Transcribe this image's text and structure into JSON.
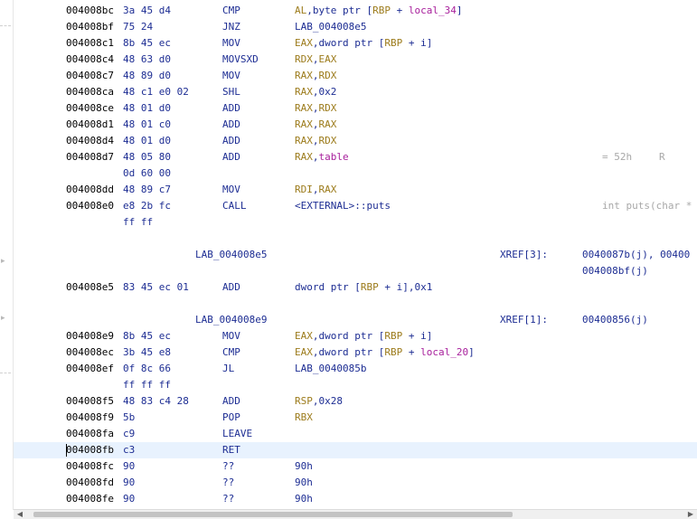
{
  "rows": [
    {
      "type": "ins",
      "addr": "004008bc",
      "bytes": "3a 45 d4",
      "mnem": "CMP",
      "ops": [
        {
          "t": "reg",
          "v": "AL"
        },
        {
          "t": "p",
          "v": ",byte ptr ["
        },
        {
          "t": "reg",
          "v": "RBP"
        },
        {
          "t": "p",
          "v": " + "
        },
        {
          "t": "var",
          "v": "local_34"
        },
        {
          "t": "p",
          "v": "]"
        }
      ]
    },
    {
      "type": "ins",
      "addr": "004008bf",
      "bytes": "75 24",
      "mnem": "JNZ",
      "ops": [
        {
          "t": "p",
          "v": "LAB_004008e5"
        }
      ]
    },
    {
      "type": "ins",
      "addr": "004008c1",
      "bytes": "8b 45 ec",
      "mnem": "MOV",
      "ops": [
        {
          "t": "reg",
          "v": "EAX"
        },
        {
          "t": "p",
          "v": ",dword ptr ["
        },
        {
          "t": "reg",
          "v": "RBP"
        },
        {
          "t": "p",
          "v": " + i]"
        }
      ]
    },
    {
      "type": "ins",
      "addr": "004008c4",
      "bytes": "48 63 d0",
      "mnem": "MOVSXD",
      "ops": [
        {
          "t": "reg",
          "v": "RDX"
        },
        {
          "t": "p",
          "v": ","
        },
        {
          "t": "reg",
          "v": "EAX"
        }
      ]
    },
    {
      "type": "ins",
      "addr": "004008c7",
      "bytes": "48 89 d0",
      "mnem": "MOV",
      "ops": [
        {
          "t": "reg",
          "v": "RAX"
        },
        {
          "t": "p",
          "v": ","
        },
        {
          "t": "reg",
          "v": "RDX"
        }
      ]
    },
    {
      "type": "ins",
      "addr": "004008ca",
      "bytes": "48 c1 e0 02",
      "mnem": "SHL",
      "ops": [
        {
          "t": "reg",
          "v": "RAX"
        },
        {
          "t": "p",
          "v": ",0x2"
        }
      ]
    },
    {
      "type": "ins",
      "addr": "004008ce",
      "bytes": "48 01 d0",
      "mnem": "ADD",
      "ops": [
        {
          "t": "reg",
          "v": "RAX"
        },
        {
          "t": "p",
          "v": ","
        },
        {
          "t": "reg",
          "v": "RDX"
        }
      ]
    },
    {
      "type": "ins",
      "addr": "004008d1",
      "bytes": "48 01 c0",
      "mnem": "ADD",
      "ops": [
        {
          "t": "reg",
          "v": "RAX"
        },
        {
          "t": "p",
          "v": ","
        },
        {
          "t": "reg",
          "v": "RAX"
        }
      ]
    },
    {
      "type": "ins",
      "addr": "004008d4",
      "bytes": "48 01 d0",
      "mnem": "ADD",
      "ops": [
        {
          "t": "reg",
          "v": "RAX"
        },
        {
          "t": "p",
          "v": ","
        },
        {
          "t": "reg",
          "v": "RDX"
        }
      ]
    },
    {
      "type": "ins",
      "addr": "004008d7",
      "bytes": "48 05 80",
      "mnem": "ADD",
      "ops": [
        {
          "t": "reg",
          "v": "RAX"
        },
        {
          "t": "p",
          "v": ","
        },
        {
          "t": "var",
          "v": "table"
        }
      ],
      "comment": "= 52h",
      "comment2": "R"
    },
    {
      "type": "cont",
      "bytes": "0d 60 00"
    },
    {
      "type": "ins",
      "addr": "004008dd",
      "bytes": "48 89 c7",
      "mnem": "MOV",
      "ops": [
        {
          "t": "reg",
          "v": "RDI"
        },
        {
          "t": "p",
          "v": ","
        },
        {
          "t": "reg",
          "v": "RAX"
        }
      ]
    },
    {
      "type": "ins",
      "addr": "004008e0",
      "bytes": "e8 2b fc",
      "mnem": "CALL",
      "ops": [
        {
          "t": "p",
          "v": "<EXTERNAL>::puts"
        }
      ],
      "comment": "int puts(char *"
    },
    {
      "type": "cont",
      "bytes": "ff ff"
    },
    {
      "type": "blank"
    },
    {
      "type": "label",
      "label": "LAB_004008e5",
      "xref": "XREF[3]:",
      "xrefv": "0040087b(j), 00400"
    },
    {
      "type": "xrefcont",
      "xrefv": "004008bf(j)"
    },
    {
      "type": "ins",
      "addr": "004008e5",
      "bytes": "83 45 ec 01",
      "mnem": "ADD",
      "ops": [
        {
          "t": "p",
          "v": "dword ptr ["
        },
        {
          "t": "reg",
          "v": "RBP"
        },
        {
          "t": "p",
          "v": " + i],0x1"
        }
      ]
    },
    {
      "type": "blank"
    },
    {
      "type": "label",
      "label": "LAB_004008e9",
      "xref": "XREF[1]:",
      "xrefv": "00400856(j)"
    },
    {
      "type": "ins",
      "addr": "004008e9",
      "bytes": "8b 45 ec",
      "mnem": "MOV",
      "ops": [
        {
          "t": "reg",
          "v": "EAX"
        },
        {
          "t": "p",
          "v": ",dword ptr ["
        },
        {
          "t": "reg",
          "v": "RBP"
        },
        {
          "t": "p",
          "v": " + i]"
        }
      ]
    },
    {
      "type": "ins",
      "addr": "004008ec",
      "bytes": "3b 45 e8",
      "mnem": "CMP",
      "ops": [
        {
          "t": "reg",
          "v": "EAX"
        },
        {
          "t": "p",
          "v": ",dword ptr ["
        },
        {
          "t": "reg",
          "v": "RBP"
        },
        {
          "t": "p",
          "v": " + "
        },
        {
          "t": "var",
          "v": "local_20"
        },
        {
          "t": "p",
          "v": "]"
        }
      ]
    },
    {
      "type": "ins",
      "addr": "004008ef",
      "bytes": "0f 8c 66",
      "mnem": "JL",
      "ops": [
        {
          "t": "p",
          "v": "LAB_0040085b"
        }
      ]
    },
    {
      "type": "cont",
      "bytes": "ff ff ff"
    },
    {
      "type": "ins",
      "addr": "004008f5",
      "bytes": "48 83 c4 28",
      "mnem": "ADD",
      "ops": [
        {
          "t": "reg",
          "v": "RSP"
        },
        {
          "t": "p",
          "v": ",0x28"
        }
      ]
    },
    {
      "type": "ins",
      "addr": "004008f9",
      "bytes": "5b",
      "mnem": "POP",
      "ops": [
        {
          "t": "reg",
          "v": "RBX"
        }
      ]
    },
    {
      "type": "ins",
      "addr": "004008fa",
      "bytes": "c9",
      "mnem": "LEAVE",
      "ops": []
    },
    {
      "type": "ins",
      "addr": "004008fb",
      "bytes": "c3",
      "mnem": "RET",
      "ops": [],
      "selected": true
    },
    {
      "type": "ins",
      "addr": "004008fc",
      "bytes": "90",
      "mnem": "??",
      "ops": [
        {
          "t": "p",
          "v": "90h"
        }
      ]
    },
    {
      "type": "ins",
      "addr": "004008fd",
      "bytes": "90",
      "mnem": "??",
      "ops": [
        {
          "t": "p",
          "v": "90h"
        }
      ]
    },
    {
      "type": "ins",
      "addr": "004008fe",
      "bytes": "90",
      "mnem": "??",
      "ops": [
        {
          "t": "p",
          "v": "90h"
        }
      ]
    }
  ],
  "gutter": {
    "arrow_glyph": "▸"
  },
  "scrollbar": {
    "left_arrow": "◀",
    "right_arrow": "▶"
  }
}
